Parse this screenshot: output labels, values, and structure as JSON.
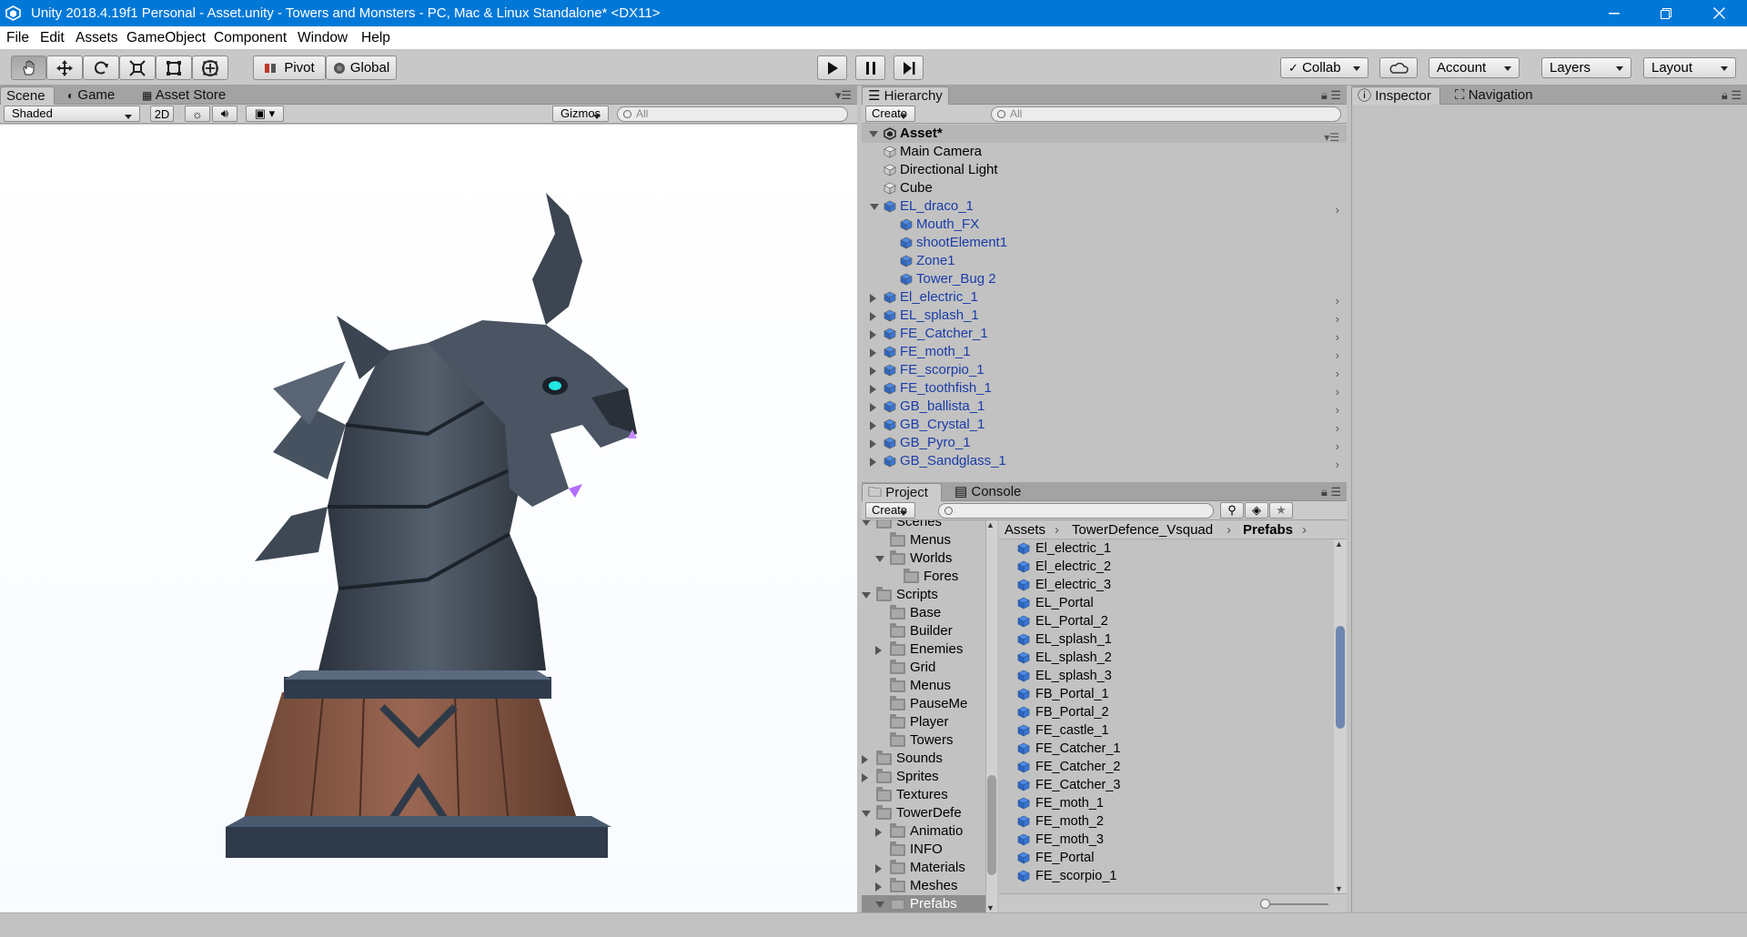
{
  "window": {
    "title": "Unity 2018.4.19f1 Personal - Asset.unity - Towers and Monsters - PC, Mac & Linux Standalone* <DX11>",
    "controls": [
      "minimize-icon",
      "restore-icon",
      "close-icon"
    ]
  },
  "menu": [
    "File",
    "Edit",
    "Assets",
    "GameObject",
    "Component",
    "Window",
    "Help"
  ],
  "toolbar": {
    "tools": [
      "hand-icon",
      "move-icon",
      "rotate-icon",
      "scale-icon",
      "rect-tool-icon",
      "transform-icon"
    ],
    "pivot": "Pivot",
    "global": "Global",
    "play": [
      "play-icon",
      "pause-icon",
      "step-icon"
    ],
    "collab": "Collab",
    "account": "Account",
    "layers": "Layers",
    "layout": "Layout"
  },
  "scene_panel": {
    "tabs": [
      "Scene",
      "Game",
      "Asset Store"
    ],
    "shading": "Shaded",
    "mode_2d": "2D",
    "gizmos": "Gizmos",
    "search_placeholder": "All"
  },
  "hierarchy": {
    "tab": "Hierarchy",
    "create": "Create",
    "search_placeholder": "All",
    "scene": "Asset*",
    "items": [
      {
        "name": "Main Camera",
        "depth": 1,
        "expand": "none",
        "prefab": false
      },
      {
        "name": "Directional Light",
        "depth": 1,
        "expand": "none",
        "prefab": false
      },
      {
        "name": "Cube",
        "depth": 1,
        "expand": "none",
        "prefab": false
      },
      {
        "name": "EL_draco_1",
        "depth": 1,
        "expand": "open",
        "prefab": true
      },
      {
        "name": "Mouth_FX",
        "depth": 2,
        "expand": "none",
        "prefab": true
      },
      {
        "name": "shootElement1",
        "depth": 2,
        "expand": "none",
        "prefab": true
      },
      {
        "name": "Zone1",
        "depth": 2,
        "expand": "none",
        "prefab": true
      },
      {
        "name": "Tower_Bug 2",
        "depth": 2,
        "expand": "none",
        "prefab": true
      },
      {
        "name": "El_electric_1",
        "depth": 1,
        "expand": "closed",
        "prefab": true
      },
      {
        "name": "EL_splash_1",
        "depth": 1,
        "expand": "closed",
        "prefab": true
      },
      {
        "name": "FE_Catcher_1",
        "depth": 1,
        "expand": "closed",
        "prefab": true
      },
      {
        "name": "FE_moth_1",
        "depth": 1,
        "expand": "closed",
        "prefab": true
      },
      {
        "name": "FE_scorpio_1",
        "depth": 1,
        "expand": "closed",
        "prefab": true
      },
      {
        "name": "FE_toothfish_1",
        "depth": 1,
        "expand": "closed",
        "prefab": true
      },
      {
        "name": "GB_ballista_1",
        "depth": 1,
        "expand": "closed",
        "prefab": true
      },
      {
        "name": "GB_Crystal_1",
        "depth": 1,
        "expand": "closed",
        "prefab": true
      },
      {
        "name": "GB_Pyro_1",
        "depth": 1,
        "expand": "closed",
        "prefab": true
      },
      {
        "name": "GB_Sandglass_1",
        "depth": 1,
        "expand": "closed",
        "prefab": true
      }
    ]
  },
  "inspector": {
    "tabs": [
      "Inspector",
      "Navigation"
    ]
  },
  "project": {
    "tabs": [
      "Project",
      "Console"
    ],
    "create": "Create",
    "breadcrumb": [
      "Assets",
      "TowerDefence_Vsquad",
      "Prefabs"
    ],
    "tree": [
      {
        "name": "Scenes",
        "depth": 1,
        "expand": "open"
      },
      {
        "name": "Menus",
        "depth": 2,
        "expand": "none"
      },
      {
        "name": "Worlds",
        "depth": 2,
        "expand": "open"
      },
      {
        "name": "Fores",
        "depth": 3,
        "expand": "none"
      },
      {
        "name": "Scripts",
        "depth": 1,
        "expand": "open"
      },
      {
        "name": "Base",
        "depth": 2,
        "expand": "none"
      },
      {
        "name": "Builder",
        "depth": 2,
        "expand": "none"
      },
      {
        "name": "Enemies",
        "depth": 2,
        "expand": "closed"
      },
      {
        "name": "Grid",
        "depth": 2,
        "expand": "none"
      },
      {
        "name": "Menus",
        "depth": 2,
        "expand": "none"
      },
      {
        "name": "PauseMe",
        "depth": 2,
        "expand": "none"
      },
      {
        "name": "Player",
        "depth": 2,
        "expand": "none"
      },
      {
        "name": "Towers",
        "depth": 2,
        "expand": "none"
      },
      {
        "name": "Sounds",
        "depth": 1,
        "expand": "closed"
      },
      {
        "name": "Sprites",
        "depth": 1,
        "expand": "closed"
      },
      {
        "name": "Textures",
        "depth": 1,
        "expand": "none"
      },
      {
        "name": "TowerDefe",
        "depth": 1,
        "expand": "open"
      },
      {
        "name": "Animatio",
        "depth": 2,
        "expand": "closed"
      },
      {
        "name": "INFO",
        "depth": 2,
        "expand": "none"
      },
      {
        "name": "Materials",
        "depth": 2,
        "expand": "closed"
      },
      {
        "name": "Meshes",
        "depth": 2,
        "expand": "closed"
      },
      {
        "name": "Prefabs",
        "depth": 2,
        "expand": "open",
        "selected": true
      }
    ],
    "files": [
      "El_electric_1",
      "El_electric_2",
      "El_electric_3",
      "EL_Portal",
      "EL_Portal_2",
      "EL_splash_1",
      "EL_splash_2",
      "EL_splash_3",
      "FB_Portal_1",
      "FB_Portal_2",
      "FE_castle_1",
      "FE_Catcher_1",
      "FE_Catcher_2",
      "FE_Catcher_3",
      "FE_moth_1",
      "FE_moth_2",
      "FE_moth_3",
      "FE_Portal",
      "FE_scorpio_1"
    ]
  }
}
